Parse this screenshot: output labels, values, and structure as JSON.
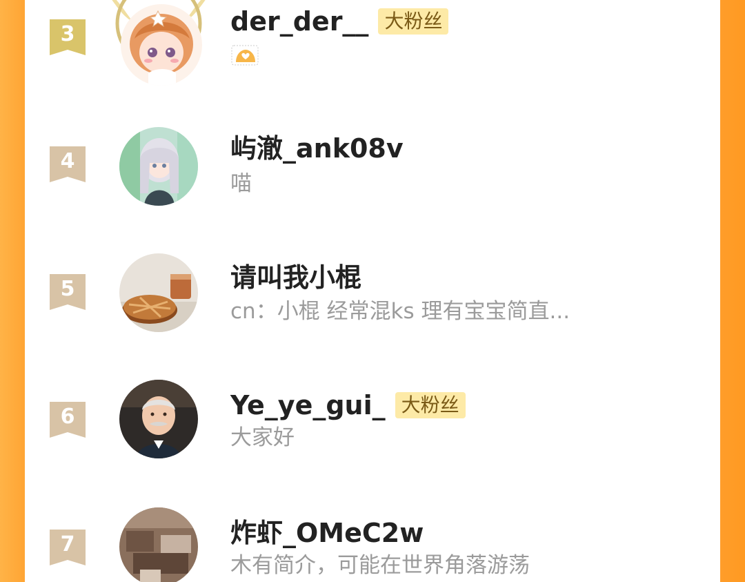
{
  "colors": {
    "side_left": "#ffa534",
    "side_right": "#ff9a22",
    "rank3": "#d9c46a",
    "rank_other": "#d8c3a6",
    "badge_bg": "#fdeaa7",
    "badge_text": "#7a5a16",
    "name_text": "#222222",
    "bio_text": "#9b9b9b"
  },
  "fans": [
    {
      "rank": "3",
      "name": "der_der__",
      "badge": "大粉丝",
      "bio_icon": "heart-sticker-icon",
      "avatar_icon": "anime-girl-avatar"
    },
    {
      "rank": "4",
      "name": "屿澈_ank08v",
      "bio": "喵",
      "avatar_icon": "anime-girl-avatar"
    },
    {
      "rank": "5",
      "name": "请叫我小棍",
      "bio": "cn：小棍 经常混ks 理有宝宝简直...",
      "avatar_icon": "pie-and-tea-avatar"
    },
    {
      "rank": "6",
      "name": "Ye_ye_gui_",
      "badge": "大粉丝",
      "bio": "大家好",
      "avatar_icon": "old-man-avatar"
    },
    {
      "rank": "7",
      "name": "炸虾_OMeC2w",
      "bio": "木有简介，可能在世界角落游荡",
      "avatar_icon": "room-photo-avatar"
    }
  ]
}
